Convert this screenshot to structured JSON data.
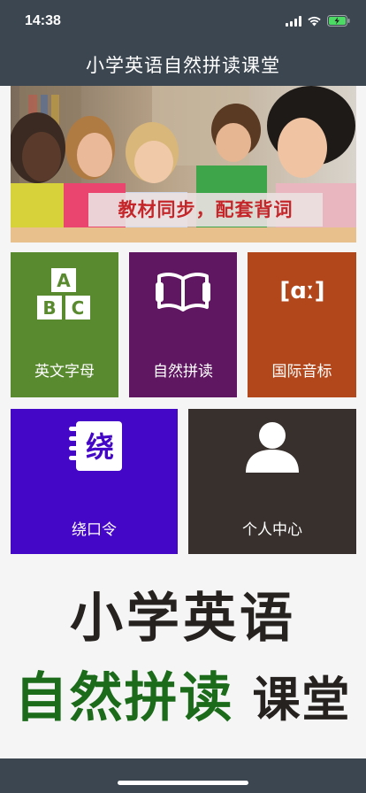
{
  "status": {
    "time": "14:38"
  },
  "header": {
    "title": "小学英语自然拼读课堂"
  },
  "banner": {
    "caption": "教材同步，配套背词"
  },
  "tiles": [
    {
      "label": "英文字母",
      "icon": "abc-blocks-icon",
      "icon_letters": [
        "A",
        "B",
        "C"
      ],
      "color": "#5a8a30"
    },
    {
      "label": "自然拼读",
      "icon": "open-book-icon",
      "color": "#5e1760"
    },
    {
      "label": "国际音标",
      "icon": "phonetic-symbol-icon",
      "icon_text": "[ɑː]",
      "color": "#b2471c"
    },
    {
      "label": "绕口令",
      "icon": "notebook-icon",
      "icon_text": "绕",
      "color": "#4407c7"
    },
    {
      "label": "个人中心",
      "icon": "person-icon",
      "color": "#38302c"
    }
  ],
  "promo": {
    "line1": "小学英语",
    "line2_green": "自然拼读",
    "line2_dark": "课堂"
  }
}
